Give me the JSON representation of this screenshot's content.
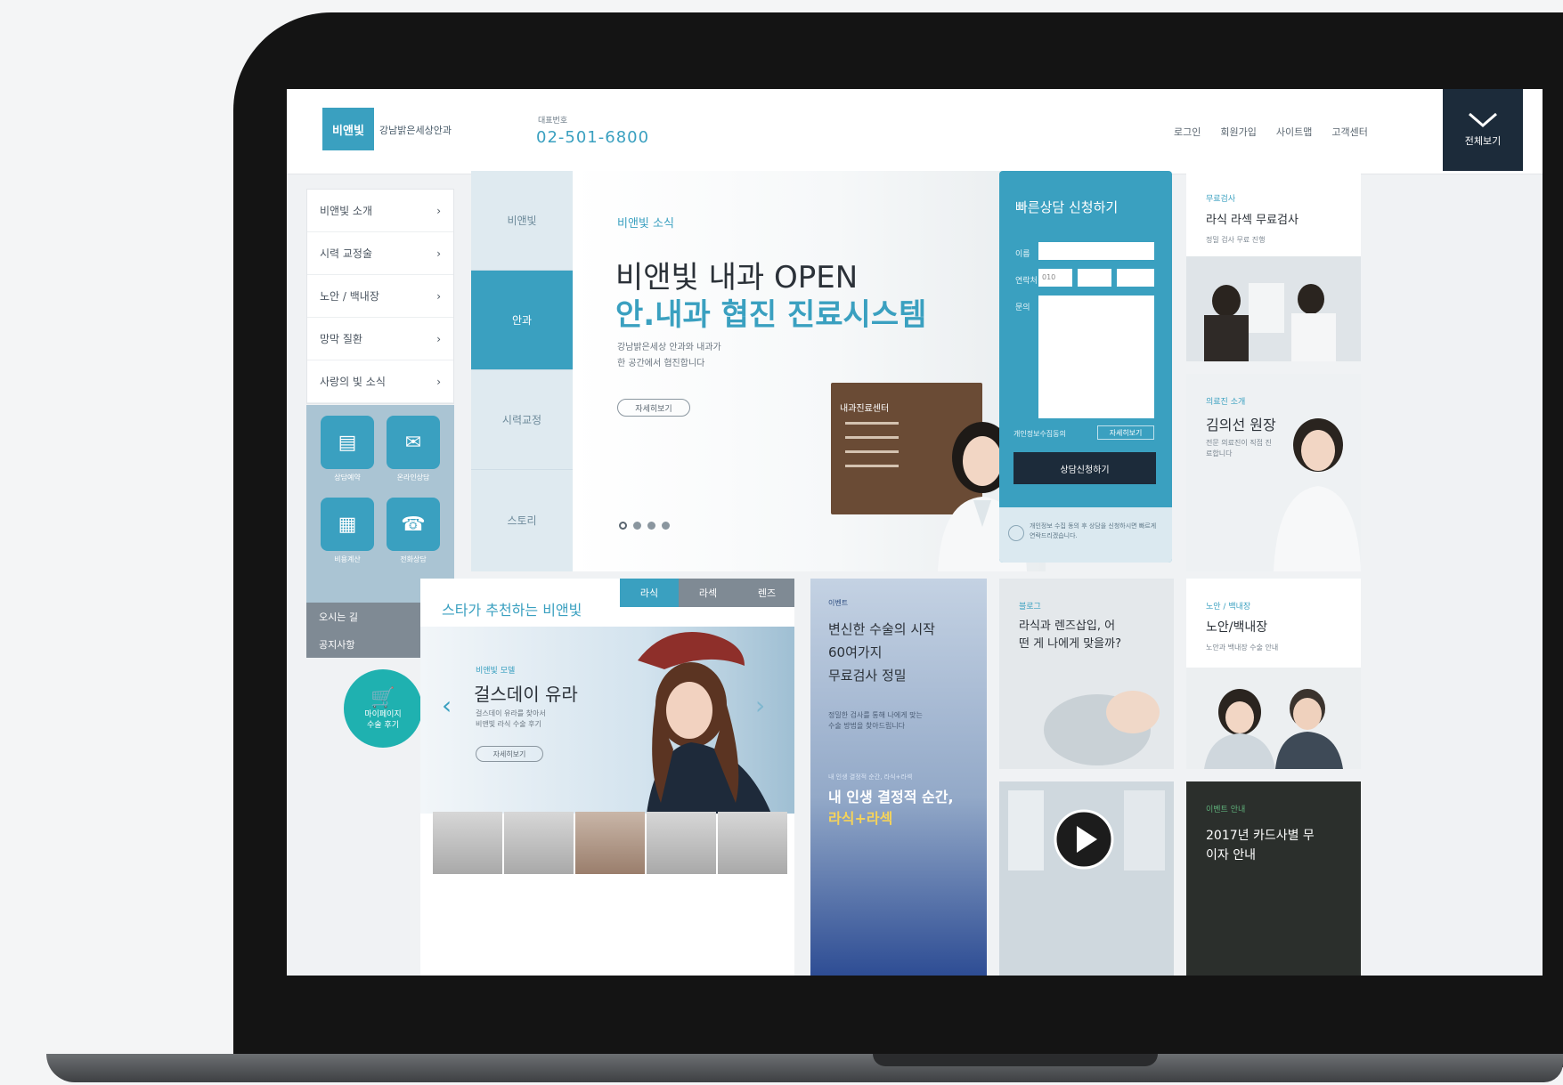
{
  "header": {
    "logo": "비앤빛",
    "tagline": "강남밝은세상안과",
    "tel_label": "대표번호",
    "tel": "02-501-6800",
    "nav": [
      "로그인",
      "회원가입",
      "사이트맵",
      "고객센터"
    ],
    "all_menu_label": "전체보기"
  },
  "sidebar": {
    "items": [
      "비앤빛 소개",
      "시력 교정술",
      "노안 / 백내장",
      "망막 질환",
      "사랑의 빛 소식"
    ],
    "quick": [
      "상담예약",
      "온라인상담",
      "비용계산",
      "전화상담"
    ],
    "links": [
      "오시는 길",
      "공지사항"
    ],
    "cart": [
      "마이페이지",
      "수술 후기"
    ]
  },
  "hero": {
    "tabs": [
      "비앤빛",
      "안과",
      "시력교정",
      "스토리"
    ],
    "active_tab": 1,
    "kicker": "비앤빛 소식",
    "title1": "비앤빛 내과 OPEN",
    "title2": "안.내과 협진 진료시스템",
    "desc1": "강남밝은세상 안과와 내과가",
    "desc2": "한 공간에서 협진합니다",
    "more": "자세히보기",
    "sign_title": "내과진료센터"
  },
  "consult": {
    "title": "빠른상담 신청하기",
    "name_label": "이름",
    "phone_label": "연락처",
    "memo_label": "문의",
    "phone_prefix": "010",
    "agree_label": "개인정보수집동의",
    "agree_btn": "자세히보기",
    "submit": "상담신청하기",
    "note": "개인정보 수집 동의 후 상담을 신청하시면 빠르게 연락드리겠습니다."
  },
  "cards": {
    "top1": {
      "kicker": "무료검사",
      "title": "라식 라섹 무료검사",
      "desc": "정밀 검사 무료 진행"
    },
    "top2": {
      "kicker": "의료진 소개",
      "title": "김의선 원장",
      "desc": "전문 의료진이 직접 진료합니다"
    },
    "mid1": {
      "kicker": "블로그",
      "title": "라식과 렌즈삽입, 어떤 게 나에게 맞을까?",
      "desc": ""
    },
    "mid2": {
      "kicker": "노안 / 백내장",
      "title": "노안/백내장",
      "desc": "노안과 백내장 수술 안내"
    },
    "bottom2": {
      "kicker": "이벤트 안내",
      "title": "2017년 카드사별 무이자 안내"
    }
  },
  "star": {
    "title": "스타가 추천하는 비앤빛",
    "tabs": [
      "라식",
      "라섹",
      "렌즈"
    ],
    "active_tab": 0,
    "kicker": "비앤빛 모델",
    "name": "걸스데이 유라",
    "desc1": "걸스데이 유라를 찾아서",
    "desc2": "비앤빛 라식 수술 후기",
    "more": "자세히보기"
  },
  "promo": {
    "kicker": "이벤트",
    "title1": "변신한 수술의 시작",
    "title2": "60여가지",
    "title3": "무료검사 정밀",
    "desc1": "정밀한 검사를 통해 나에게 맞는",
    "desc2": "수술 방법을 찾아드립니다",
    "small": "내 인생 결정적 순간, 라식+라섹",
    "big1": "내 인생 결정적 순간,",
    "big2": "라식+라섹"
  },
  "colors": {
    "accent": "#3aa0c0",
    "dark": "#1c2b3a",
    "teal": "#1fb1b0"
  }
}
